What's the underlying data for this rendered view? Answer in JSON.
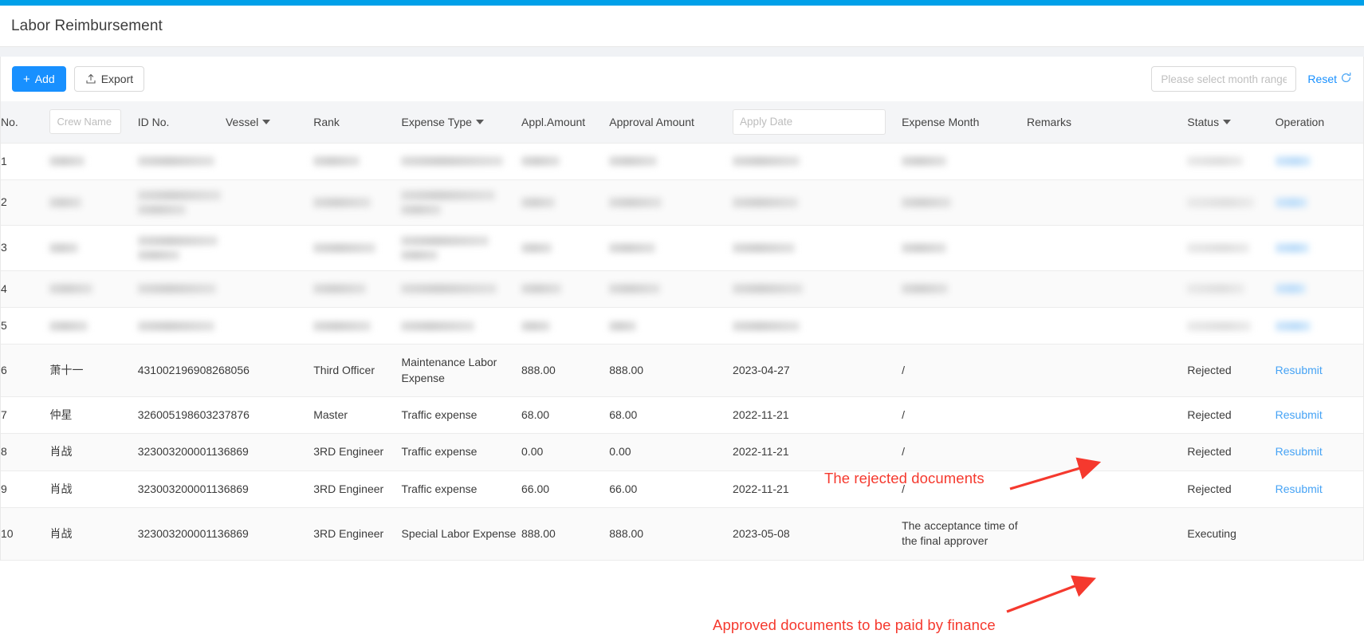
{
  "header": {
    "title": "Labor Reimbursement"
  },
  "toolbar": {
    "add_label": "Add",
    "export_label": "Export",
    "month_range_placeholder": "Please select month range",
    "reset_label": "Reset"
  },
  "table": {
    "columns": {
      "no": "No.",
      "crew_name_placeholder": "Crew Name",
      "id_no": "ID No.",
      "vessel": "Vessel",
      "rank": "Rank",
      "expense_type": "Expense Type",
      "appl_amount": "Appl.Amount",
      "approval_amount": "Approval Amount",
      "apply_date_placeholder": "Apply Date",
      "expense_month": "Expense Month",
      "remarks": "Remarks",
      "status": "Status",
      "operation": "Operation"
    },
    "rows": [
      {
        "no": "1",
        "redacted": true
      },
      {
        "no": "2",
        "redacted": true
      },
      {
        "no": "3",
        "redacted": true
      },
      {
        "no": "4",
        "redacted": true
      },
      {
        "no": "5",
        "redacted": true
      },
      {
        "no": "6",
        "crew_name": "萧十一",
        "id_no": "431002196908268056",
        "vessel": "",
        "rank": "Third Officer",
        "expense_type": "Maintenance Labor Expense",
        "appl_amount": "888.00",
        "approval_amount": "888.00",
        "apply_date": "2023-04-27",
        "expense_month": "/",
        "remarks": "",
        "status": "Rejected",
        "operation": "Resubmit"
      },
      {
        "no": "7",
        "crew_name": "仲星",
        "id_no": "326005198603237876",
        "vessel": "",
        "rank": "Master",
        "expense_type": "Traffic expense",
        "appl_amount": "68.00",
        "approval_amount": "68.00",
        "apply_date": "2022-11-21",
        "expense_month": "/",
        "remarks": "",
        "status": "Rejected",
        "operation": "Resubmit"
      },
      {
        "no": "8",
        "crew_name": "肖战",
        "id_no": "323003200001136869",
        "vessel": "",
        "rank": "3RD Engineer",
        "expense_type": "Traffic expense",
        "appl_amount": "0.00",
        "approval_amount": "0.00",
        "apply_date": "2022-11-21",
        "expense_month": "/",
        "remarks": "",
        "status": "Rejected",
        "operation": "Resubmit"
      },
      {
        "no": "9",
        "crew_name": "肖战",
        "id_no": "323003200001136869",
        "vessel": "",
        "rank": "3RD Engineer",
        "expense_type": "Traffic expense",
        "appl_amount": "66.00",
        "approval_amount": "66.00",
        "apply_date": "2022-11-21",
        "expense_month": "/",
        "remarks": "",
        "status": "Rejected",
        "operation": "Resubmit"
      },
      {
        "no": "10",
        "crew_name": "肖战",
        "id_no": "323003200001136869",
        "vessel": "",
        "rank": "3RD Engineer",
        "expense_type": "Special Labor Expense",
        "appl_amount": "888.00",
        "approval_amount": "888.00",
        "apply_date": "2023-05-08",
        "expense_month": "The acceptance time of the final approver",
        "remarks": "",
        "status": "Executing",
        "operation": ""
      }
    ]
  },
  "annotations": {
    "rejected_note": "The rejected documents",
    "approved_note": "Approved documents to be paid by finance",
    "color": "#f5392e"
  },
  "colors": {
    "accent_bar": "#00a0e9",
    "primary_button": "#1890ff",
    "link": "#46a3f5",
    "header_row": "#f4f5f7"
  }
}
